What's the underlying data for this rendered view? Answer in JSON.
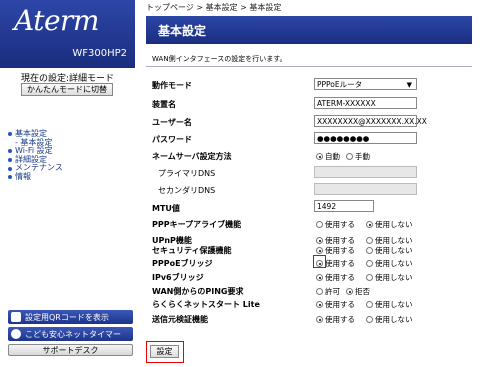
{
  "sidebar": {
    "logo": "Aterm",
    "model": "WF300HP2",
    "mode_text": "現在の設定:詳細モード",
    "mode_button": "かんたんモードに切替",
    "menu": [
      {
        "label": "基本設定",
        "sub": false
      },
      {
        "label": "- 基本設定",
        "sub": true
      },
      {
        "label": "Wi-Fi 設定",
        "sub": false
      },
      {
        "label": "詳細設定",
        "sub": false
      },
      {
        "label": "メンテナンス",
        "sub": false
      },
      {
        "label": "情報",
        "sub": false
      }
    ],
    "qr_button": "設定用QRコードを表示",
    "kids_button": "こども安心ネットタイマー",
    "support_button": "サポートデスク"
  },
  "breadcrumb": "トップページ > 基本設定 > 基本設定",
  "page_title": "基本設定",
  "description": "WAN側インタフェースの設定を行います。",
  "form": {
    "operation_mode": {
      "label": "動作モード",
      "value": "PPPoEルータ"
    },
    "device_name": {
      "label": "装置名",
      "value": "ATERM-XXXXXX"
    },
    "username": {
      "label": "ユーザー名",
      "value": "XXXXXXXX@XXXXXXX.XX.XX"
    },
    "password": {
      "label": "パスワード",
      "value": "●●●●●●●●"
    },
    "dns_method": {
      "label": "ネームサーバ設定方法",
      "opt1": "自動",
      "opt2": "手動"
    },
    "primary_dns": {
      "label": "プライマリDNS",
      "value": ""
    },
    "secondary_dns": {
      "label": "セカンダリDNS",
      "value": ""
    },
    "mtu": {
      "label": "MTU値",
      "value": "1492"
    },
    "keepalive": {
      "label": "PPPキープアライブ機能",
      "opt1": "使用する",
      "opt2": "使用しない"
    },
    "upnp": {
      "label": "UPnP機能",
      "opt1": "使用する",
      "opt2": "使用しない"
    },
    "security": {
      "label": "セキュリティ保護機能",
      "opt1": "使用する",
      "opt2": "使用しない"
    },
    "pppoe_bridge": {
      "label": "PPPoEブリッジ",
      "opt1": "使用する",
      "opt2": "使用しない"
    },
    "ipv6_bridge": {
      "label": "IPv6ブリッジ",
      "opt1": "使用する",
      "opt2": "使用しない"
    },
    "wan_ping": {
      "label": "WAN側からのPING要求",
      "opt1": "許可",
      "opt2": "拒否"
    },
    "easy_net": {
      "label": "らくらくネットスタート Lite",
      "opt1": "使用する",
      "opt2": "使用しない"
    },
    "sender_verify": {
      "label": "送信元検証機能",
      "opt1": "使用する",
      "opt2": "使用しない"
    }
  },
  "submit_label": "設定"
}
